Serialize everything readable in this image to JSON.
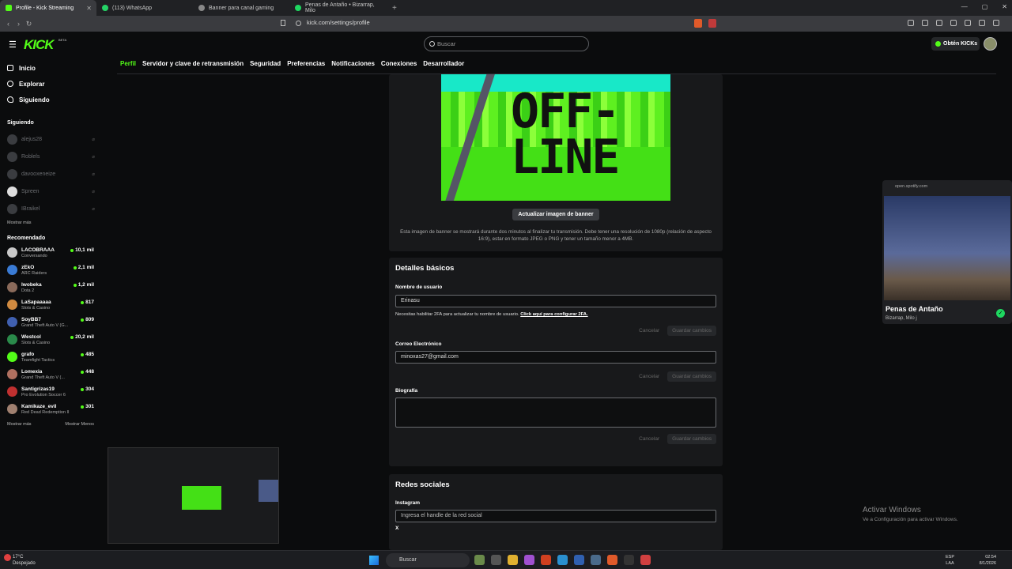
{
  "browser": {
    "tabs": [
      {
        "label": "Profile - Kick Streaming",
        "active": true,
        "color": "#53fc18"
      },
      {
        "label": "(113) WhatsApp",
        "active": false,
        "color": "#25d366"
      },
      {
        "label": "Banner para canal gaming",
        "active": false,
        "color": "#888888"
      },
      {
        "label": "Penas de Antaño • Bizarrap, Milo",
        "active": false,
        "color": "#1ed760"
      }
    ],
    "url": "kick.com/settings/profile"
  },
  "header": {
    "logo": "KICK",
    "beta": "BETA",
    "search_placeholder": "Buscar",
    "get_kicks": "Obtén KICKs"
  },
  "sidebar": {
    "nav": [
      {
        "label": "Inicio",
        "icon": "home-icon"
      },
      {
        "label": "Explorar",
        "icon": "compass-icon"
      },
      {
        "label": "Siguiendo",
        "icon": "heart-icon"
      }
    ],
    "following_title": "Siguiendo",
    "following": [
      "alejus28",
      "Roblels",
      "davooxeneize",
      "Spreen",
      "IBraikel"
    ],
    "show_more": "Mostrar más",
    "recommended_title": "Recomendado",
    "recommended": [
      {
        "name": "LACOBRAAA",
        "game": "Conversando",
        "viewers": "10,1 mil",
        "color": "#c8c8c8"
      },
      {
        "name": "zEkO",
        "game": "ARC Raiders",
        "viewers": "2,1 mil",
        "color": "#3a7bd5"
      },
      {
        "name": "lwobeka",
        "game": "Dota 2",
        "viewers": "1,2 mil",
        "color": "#8a6a5a"
      },
      {
        "name": "LaSapaaaaa",
        "game": "Slots & Casino",
        "viewers": "817",
        "color": "#d08a40"
      },
      {
        "name": "SoyBB7",
        "game": "Grand Theft Auto V (G...",
        "viewers": "809",
        "color": "#4060b0"
      },
      {
        "name": "Westcol",
        "game": "Slots & Casino",
        "viewers": "20,2 mil",
        "color": "#2a8a4a"
      },
      {
        "name": "grafo",
        "game": "Teamfight Tactics",
        "viewers": "485",
        "color": "#53fc18"
      },
      {
        "name": "Lomexia",
        "game": "Grand Theft Auto V (...",
        "viewers": "448",
        "color": "#b07060"
      },
      {
        "name": "Santigrizas19",
        "game": "Pro Evolution Soccer 6",
        "viewers": "304",
        "color": "#c03030"
      },
      {
        "name": "Kamikaze_evil",
        "game": "Red Dead Redemption II",
        "viewers": "301",
        "color": "#a08070"
      }
    ],
    "show_more_bottom": "Mostrar más",
    "show_less": "Mostrar Menos"
  },
  "settings_tabs": [
    "Perfil",
    "Servidor y clave de retransmisión",
    "Seguridad",
    "Preferencias",
    "Notificaciones",
    "Conexiones",
    "Desarrollador"
  ],
  "banner": {
    "text_line1": "OFF-",
    "text_line2": "LINE",
    "update_button": "Actualizar imagen de banner",
    "note": "Esta imagen de banner se mostrará durante dos minutos al finalizar tu transmisión. Debe tener una resolución de 1080p (relación de aspecto 16:9), estar en formato JPEG o PNG y tener un tamaño menor a 4MB."
  },
  "basic": {
    "title": "Detalles básicos",
    "username_label": "Nombre de usuario",
    "username_value": "Erinasu",
    "twofa_note": "Necesitas habilitar 2FA para actualizar tu nombre de usuario.",
    "twofa_link": "Click aquí para configurar 2FA.",
    "email_label": "Correo Electrónico",
    "email_value": "minoxas27@gmail.com",
    "bio_label": "Biografía",
    "cancel": "Cancelar",
    "save": "Guardar cambios"
  },
  "social": {
    "title": "Redes sociales",
    "instagram_label": "Instagram",
    "instagram_placeholder": "Ingresa el handle de la red social",
    "x_label": "X"
  },
  "spotify": {
    "url": "open.spotify.com",
    "title": "Penas de Antaño",
    "artist": "Bizarrap, Milo j"
  },
  "watermark": {
    "line1": "Activar Windows",
    "line2": "Ve a Configuración para activar Windows."
  },
  "taskbar": {
    "temp": "17°C",
    "weather": "Despejado",
    "search": "Buscar",
    "lang1": "ESP",
    "lang2": "LAA",
    "time": "02:54",
    "date": "8/1/2026"
  }
}
